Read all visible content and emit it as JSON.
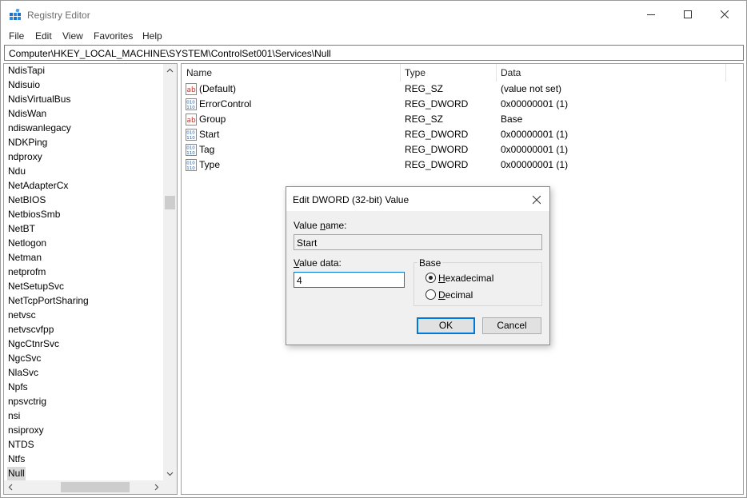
{
  "window": {
    "title": "Registry Editor"
  },
  "menu": [
    "File",
    "Edit",
    "View",
    "Favorites",
    "Help"
  ],
  "address": "Computer\\HKEY_LOCAL_MACHINE\\SYSTEM\\ControlSet001\\Services\\Null",
  "tree": {
    "items": [
      "NdisTapi",
      "Ndisuio",
      "NdisVirtualBus",
      "NdisWan",
      "ndiswanlegacy",
      "NDKPing",
      "ndproxy",
      "Ndu",
      "NetAdapterCx",
      "NetBIOS",
      "NetbiosSmb",
      "NetBT",
      "Netlogon",
      "Netman",
      "netprofm",
      "NetSetupSvc",
      "NetTcpPortSharing",
      "netvsc",
      "netvscvfpp",
      "NgcCtnrSvc",
      "NgcSvc",
      "NlaSvc",
      "Npfs",
      "npsvctrig",
      "nsi",
      "nsiproxy",
      "NTDS",
      "Ntfs",
      "Null"
    ],
    "selected_index": 28
  },
  "values_pane": {
    "headers": {
      "name": "Name",
      "type": "Type",
      "data": "Data"
    },
    "rows": [
      {
        "icon": "string-value-icon",
        "name": "(Default)",
        "type": "REG_SZ",
        "data": "(value not set)"
      },
      {
        "icon": "binary-value-icon",
        "name": "ErrorControl",
        "type": "REG_DWORD",
        "data": "0x00000001 (1)"
      },
      {
        "icon": "string-value-icon",
        "name": "Group",
        "type": "REG_SZ",
        "data": "Base"
      },
      {
        "icon": "binary-value-icon",
        "name": "Start",
        "type": "REG_DWORD",
        "data": "0x00000001 (1)"
      },
      {
        "icon": "binary-value-icon",
        "name": "Tag",
        "type": "REG_DWORD",
        "data": "0x00000001 (1)"
      },
      {
        "icon": "binary-value-icon",
        "name": "Type",
        "type": "REG_DWORD",
        "data": "0x00000001 (1)"
      }
    ]
  },
  "dialog": {
    "title": "Edit DWORD (32-bit) Value",
    "value_name_label_pre": "Value ",
    "value_name_label_ul": "n",
    "value_name_label_post": "ame:",
    "value_name": "Start",
    "value_data_label_pre": "",
    "value_data_label_ul": "V",
    "value_data_label_post": "alue data:",
    "value_data": "4",
    "base_label": "Base",
    "hex_ul": "H",
    "hex_rest": "exadecimal",
    "dec_ul": "D",
    "dec_rest": "ecimal",
    "base_selected": "hexadecimal",
    "ok_label": "OK",
    "cancel_label": "Cancel"
  }
}
